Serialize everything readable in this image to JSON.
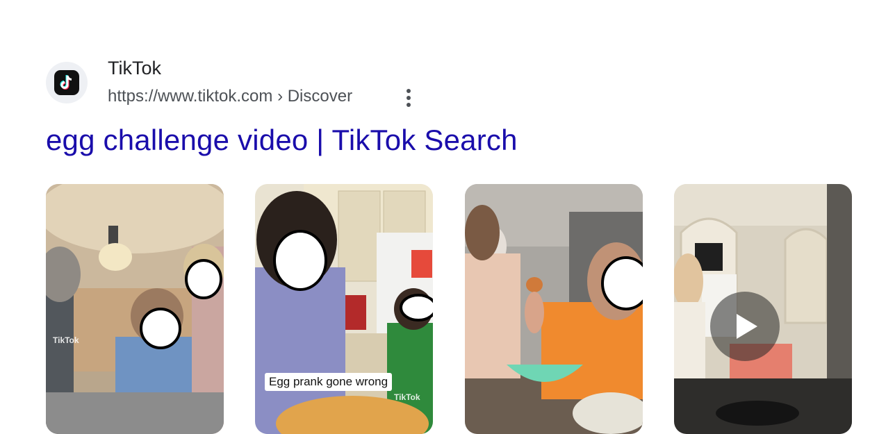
{
  "result": {
    "site_name": "TikTok",
    "url": "https://www.tiktok.com › Discover",
    "title": "egg challenge video | TikTok Search"
  },
  "icons": {
    "favicon": "tiktok-logo-icon",
    "menu": "more-vert-icon",
    "play": "play-icon"
  },
  "videos": [
    {
      "caption": "",
      "watermark": "TikTok"
    },
    {
      "caption": "Egg prank gone wrong",
      "watermark": "TikTok"
    },
    {
      "caption": "",
      "watermark": ""
    },
    {
      "caption": "",
      "watermark": "",
      "has_play_button": true
    }
  ],
  "colors": {
    "title_link": "#1a0dab",
    "url_text": "#4d5156",
    "site_name": "#202124"
  }
}
